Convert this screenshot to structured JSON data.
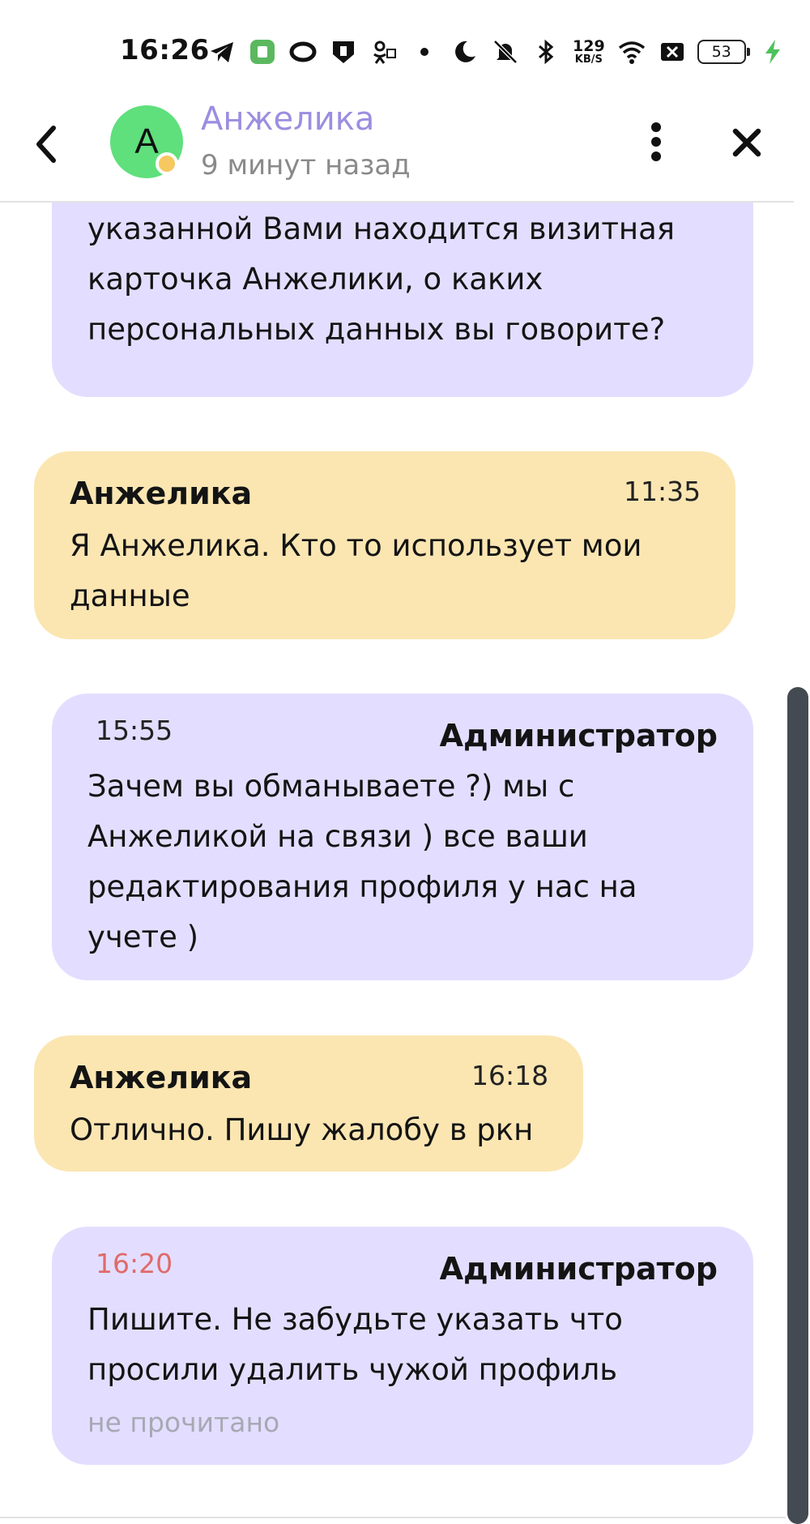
{
  "status_bar": {
    "time": "16:26",
    "network_speed_value": "129",
    "network_speed_unit": "KB/S",
    "battery_level": "53",
    "icons": [
      "telegram-icon",
      "app-icon",
      "circle-app-icon",
      "shield-app-icon",
      "ok-icon",
      "dot-icon",
      "moon-icon",
      "bell-muted-icon",
      "bluetooth-icon",
      "network-speed",
      "wifi-icon",
      "sim-x-icon",
      "battery-icon",
      "charging-icon"
    ]
  },
  "header": {
    "avatar_letter": "A",
    "name": "Анжелика",
    "status": "9 минут назад",
    "icons": {
      "back": "chevron-left-icon",
      "menu": "more-vertical-icon",
      "close": "close-icon"
    }
  },
  "messages": [
    {
      "role": "admin",
      "text": "Здравствуйте Сергей, по ссылке\nуказанной Вами находится визитная\nкарточка Анжелики, о каких\nперсональных данных вы говорите?"
    },
    {
      "role": "user",
      "author": "Анжелика",
      "time": "11:35",
      "text": "Я Анжелика. Кто то использует мои\nданные"
    },
    {
      "role": "admin",
      "author": "Администратор",
      "time": "15:55",
      "text": "Зачем вы обманываете ?) мы с\nАнжеликой на связи ) все ваши\nредактирования профиля у нас на\nучете )"
    },
    {
      "role": "user",
      "author": "Анжелика",
      "time": "16:18",
      "text": "Отлично. Пишу жалобу в ркн"
    },
    {
      "role": "admin",
      "author": "Администратор",
      "time": "16:20",
      "text": "Пишите. Не забудьте указать что\nпросили удалить чужой профиль",
      "receipt": "не прочитано"
    }
  ],
  "colors": {
    "admin_bubble": "#e3deff",
    "user_bubble": "#fbe6b2",
    "contact_name": "#9b8ee0",
    "avatar": "#5fe07c",
    "unread_time": "#e06a6a"
  }
}
